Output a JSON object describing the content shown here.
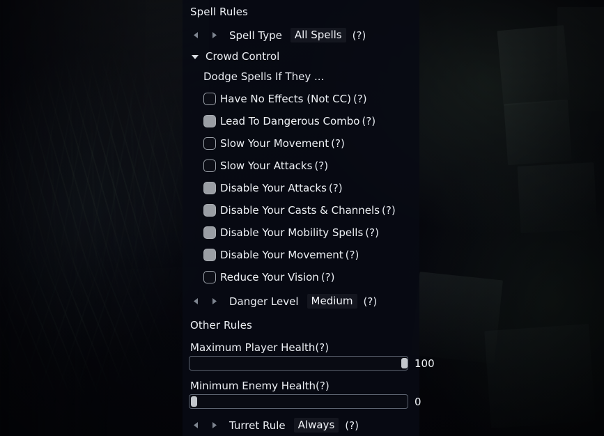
{
  "panel": {
    "spell_rules_title": "Spell Rules",
    "other_rules_title": "Other Rules",
    "help_glyph": "(?)"
  },
  "spell_type": {
    "label": "Spell Type",
    "value": "All Spells",
    "help": "(?)",
    "prev_icon": "triangle-left-icon",
    "next_icon": "triangle-right-icon"
  },
  "crowd_control": {
    "group_label": "Crowd Control",
    "expand_icon": "triangle-down-icon",
    "sub_label": "Dodge Spells If They ...",
    "options": [
      {
        "label": "Have No Effects (Not CC)",
        "help": "(?)",
        "checked": false
      },
      {
        "label": "Lead To Dangerous Combo",
        "help": "(?)",
        "checked": true
      },
      {
        "label": "Slow Your Movement",
        "help": "(?)",
        "checked": false
      },
      {
        "label": "Slow Your Attacks",
        "help": "(?)",
        "checked": false
      },
      {
        "label": "Disable Your Attacks",
        "help": "(?)",
        "checked": true
      },
      {
        "label": "Disable Your Casts & Channels",
        "help": "(?)",
        "checked": true
      },
      {
        "label": "Disable Your Mobility Spells",
        "help": "(?)",
        "checked": true
      },
      {
        "label": "Disable Your Movement",
        "help": "(?)",
        "checked": true
      },
      {
        "label": "Reduce Your Vision",
        "help": "(?)",
        "checked": false
      }
    ]
  },
  "danger_level": {
    "label": "Danger Level",
    "value": "Medium",
    "help": "(?)",
    "prev_icon": "triangle-left-icon",
    "next_icon": "triangle-right-icon"
  },
  "max_player_health": {
    "label": "Maximum Player Health",
    "help": "(?)",
    "value": "100",
    "percent": 100
  },
  "min_enemy_health": {
    "label": "Minimum Enemy Health",
    "help": "(?)",
    "value": "0",
    "percent": 0
  },
  "turret_rule": {
    "label": "Turret Rule",
    "value": "Always",
    "help": "(?)",
    "prev_icon": "triangle-left-icon",
    "next_icon": "triangle-right-icon"
  },
  "colors": {
    "panel_bg": "#080a13",
    "text": "#eceff4",
    "checkbox_fill": "#9a9ea4",
    "checkbox_border": "#9aa0a8",
    "slider_handle": "#c3c7cc",
    "slider_border": "#5c6370"
  }
}
